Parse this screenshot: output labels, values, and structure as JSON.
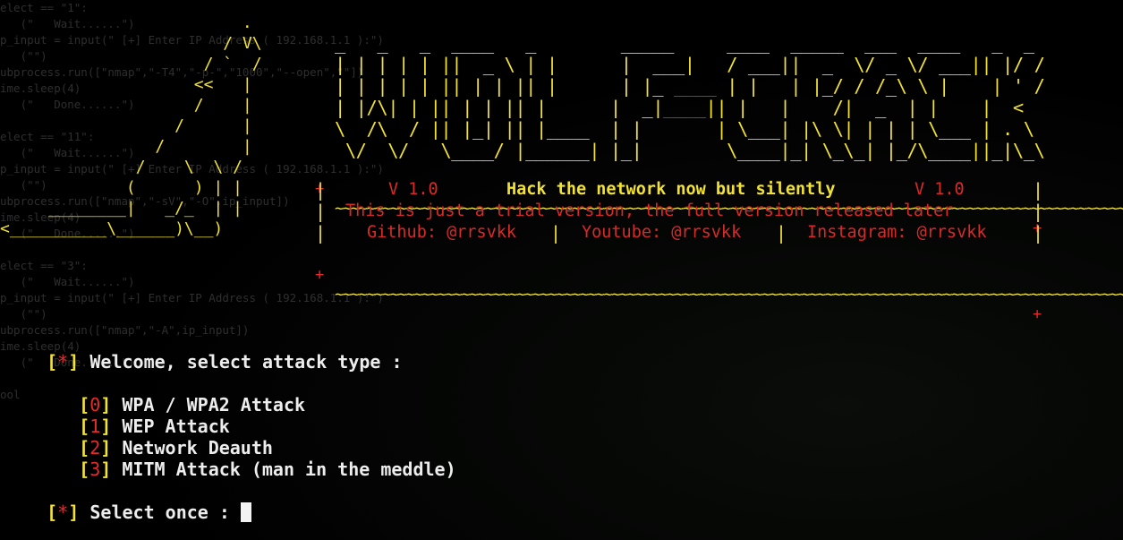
{
  "background_code": [
    "elect == \"1\":",
    "   (\"   Wait......\")",
    "p_input = input(\" [+] Enter IP Address ( 192.168.1.1 ):\")",
    "   (\"\")",
    "ubprocess.run([\"nmap\",\"-T4\",\"-p-\",\"1000\",\"--open\",\"\"])",
    "ime.sleep(4)",
    "   (\"   Done......\")",
    "",
    "elect == \"11\":",
    "   (\"   Wait......\")",
    "p_input = input(\" [+] Enter IP Address ( 192.168.1.1 ):\")",
    "   (\"\")",
    "ubprocess.run([\"nmap\",\"-sV\",\"-O\",ip_input])",
    "ime.sleep(4)",
    "   (\"   Done......\")",
    "",
    "elect == \"3\":",
    "   (\"   Wait......\")",
    "p_input = input(\" [+] Enter IP Address ( 192.168.1.1 ):\")",
    "   (\"\")",
    "ubprocess.run([\"nmap\",\"-A\",ip_input])",
    "ime.sleep(4)",
    "   (\"   Done......\")",
    "",
    "ool"
  ],
  "wolf_art": [
    "                         .",
    "                       / V\\",
    "                     / `  /",
    "                    <<   |",
    "                    /    |",
    "                  /      |",
    "                /        |",
    "              /    \\  \\ /",
    "             (      ) | |",
    "     ________|   _/_  | |",
    "<__________\\______)\\__)"
  ],
  "logo_art": [
    "_   _   _  ____   _        _____     ____  _____  ___  ____   _  _",
    "| | | | | ||  _ \\ | |      |  ___|   / ___||  _  \\/ _ \\/ ___|| |/ /",
    "| | | | | || | | || |      | |_ ____ | |   | |_/ / /_\\ \\ |    | ' /",
    "| |/\\| | || | | || |      |  _|____|| |   |    /|  _  | |    |  <",
    "\\  /\\  / || |_| || |____  | |       | \\___| |\\ \\| | | | \\___ | . \\",
    " \\/  \\/   \\____/ |______| |_|        \\____|_| \\_\\_| |_/\\____||_|\\_\\"
  ],
  "banner": {
    "version_left": "V 1.0",
    "tagline": "Hack the network now but silently",
    "version_right": "V 1.0",
    "trial_notice": "This is just a trial version, the full version released later",
    "github": "Github: @rrsvkk",
    "youtube": "Youtube: @rrsvkk",
    "instagram": "Instagram: @rrsvkk",
    "separator": "|",
    "border_corner": "+",
    "border_line": "~~~~~~~~~~~~~~~~~~~~~~~~~~~~~~~~~~~~~~~~~~~~~~~~~~~~~~~~~~~~~~~~~~~~~~~~~~~~~~~~~~~~~~~~~~~~~~~~~~~~~~~~~"
  },
  "prompt": {
    "marker_open": "[",
    "marker_star": "*",
    "marker_close": "]",
    "welcome": "Welcome, select attack type :",
    "select": "Select once :"
  },
  "menu": [
    {
      "index": "0",
      "label": "WPA / WPA2 Attack"
    },
    {
      "index": "1",
      "label": "WEP Attack"
    },
    {
      "index": "2",
      "label": "Network Deauth"
    },
    {
      "index": "3",
      "label": "MITM Attack (man in the meddle)"
    }
  ],
  "colors": {
    "background": "#000000",
    "accent_yellow": "#f2e233",
    "accent_red": "#e52b2b",
    "text": "#ededed",
    "ghost_text": "#555555"
  }
}
